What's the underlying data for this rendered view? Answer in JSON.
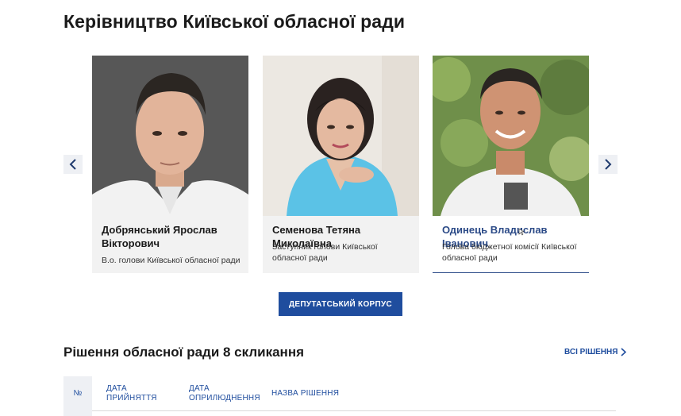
{
  "leadership": {
    "title": "Керівництво Київської обласної ради",
    "cards": [
      {
        "name": "Добрянський Ярослав Вікторович",
        "role": "В.о. голови Київської обласної ради"
      },
      {
        "name": "Семенова Тетяна Миколаївна",
        "role": "Заступник голови Київської обласної ради"
      },
      {
        "name": "Одинець Владислав Іванович",
        "role": "Голова бюджетної комісії Київської обласної ради"
      }
    ],
    "prev_icon": "chevron-left-icon",
    "next_icon": "chevron-right-icon",
    "button_label": "ДЕПУТАТСЬКИЙ КОРПУС"
  },
  "decisions": {
    "title": "Рішення обласної ради 8 скликання",
    "all_link": "ВСІ РІШЕННЯ",
    "columns": [
      "№",
      "ДАТА ПРИЙНЯТТЯ",
      "ДАТА ОПРИЛЮДНЕННЯ",
      "НАЗВА РІШЕННЯ"
    ]
  },
  "colors": {
    "accent": "#1f4d9e",
    "card_bg": "#f2f2f2",
    "arrow_bg": "#eef0f4",
    "link_name": "#2b4a87"
  }
}
